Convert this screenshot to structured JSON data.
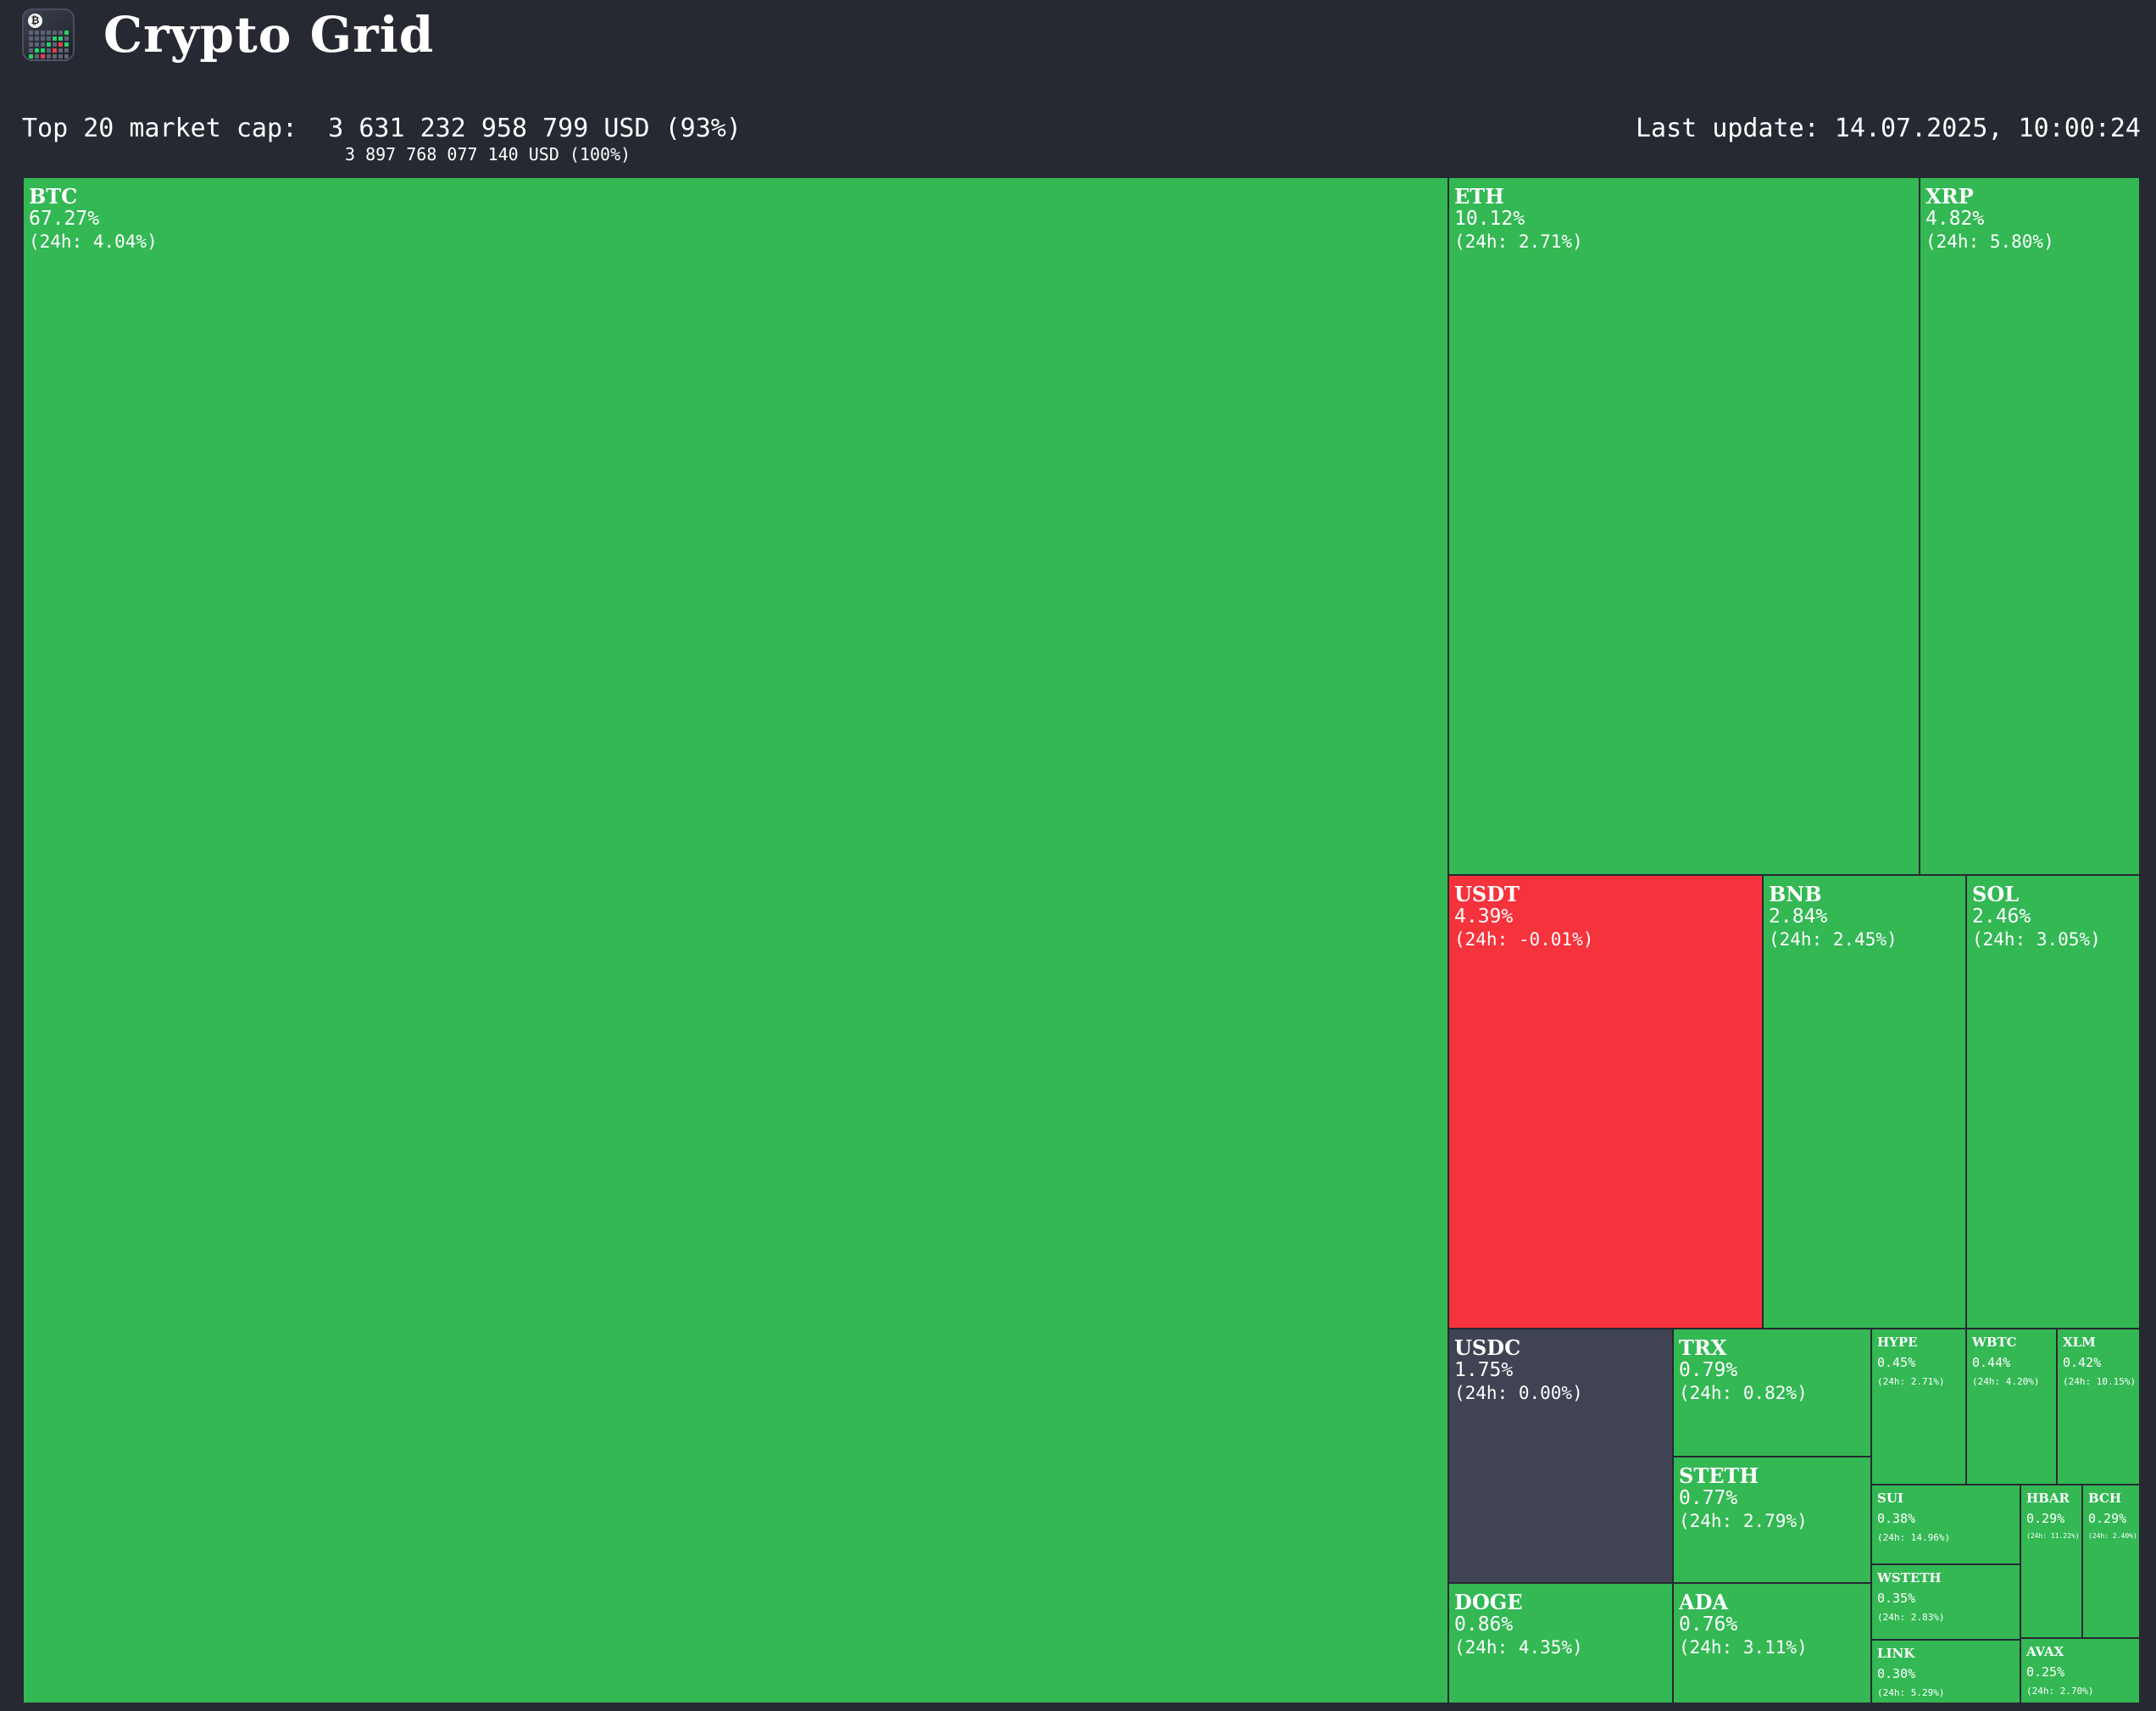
{
  "app": {
    "title": "Crypto Grid",
    "logo_icon": "bitcoin-grid-logo-icon"
  },
  "summary": {
    "label": "Top 20 market cap:",
    "top20_value": "3 631 232 958 799 USD (93%)",
    "total_value": "3 897 768 077 140 USD (100%)",
    "last_update_label": "Last update:",
    "last_update_value": "14.07.2025, 10:00:24"
  },
  "colors": {
    "background": "#262932",
    "positive": "#33b854",
    "negative": "#f5333c",
    "neutral": "#3f4353"
  },
  "tiles": [
    {
      "symbol": "BTC",
      "share": "67.27%",
      "change": "(24h: 4.04%)",
      "change_value": 4.04
    },
    {
      "symbol": "ETH",
      "share": "10.12%",
      "change": "(24h: 2.71%)",
      "change_value": 2.71
    },
    {
      "symbol": "XRP",
      "share": "4.82%",
      "change": "(24h: 5.80%)",
      "change_value": 5.8
    },
    {
      "symbol": "USDT",
      "share": "4.39%",
      "change": "(24h: -0.01%)",
      "change_value": -0.01
    },
    {
      "symbol": "BNB",
      "share": "2.84%",
      "change": "(24h: 2.45%)",
      "change_value": 2.45
    },
    {
      "symbol": "SOL",
      "share": "2.46%",
      "change": "(24h: 3.05%)",
      "change_value": 3.05
    },
    {
      "symbol": "USDC",
      "share": "1.75%",
      "change": "(24h: 0.00%)",
      "change_value": 0.0
    },
    {
      "symbol": "TRX",
      "share": "0.79%",
      "change": "(24h: 0.82%)",
      "change_value": 0.82
    },
    {
      "symbol": "STETH",
      "share": "0.77%",
      "change": "(24h: 2.79%)",
      "change_value": 2.79
    },
    {
      "symbol": "DOGE",
      "share": "0.86%",
      "change": "(24h: 4.35%)",
      "change_value": 4.35
    },
    {
      "symbol": "ADA",
      "share": "0.76%",
      "change": "(24h: 3.11%)",
      "change_value": 3.11
    },
    {
      "symbol": "HYPE",
      "share": "0.45%",
      "change": "(24h: 2.71%)",
      "change_value": 2.71
    },
    {
      "symbol": "WBTC",
      "share": "0.44%",
      "change": "(24h: 4.20%)",
      "change_value": 4.2
    },
    {
      "symbol": "XLM",
      "share": "0.42%",
      "change": "(24h: 10.15%)",
      "change_value": 10.15
    },
    {
      "symbol": "SUI",
      "share": "0.38%",
      "change": "(24h: 14.96%)",
      "change_value": 14.96
    },
    {
      "symbol": "HBAR",
      "share": "0.29%",
      "change": "(24h: 11.22%)",
      "change_value": 11.22
    },
    {
      "symbol": "BCH",
      "share": "0.29%",
      "change": "(24h: 2.40%)",
      "change_value": 2.4
    },
    {
      "symbol": "WSTETH",
      "share": "0.35%",
      "change": "(24h: 2.83%)",
      "change_value": 2.83
    },
    {
      "symbol": "LINK",
      "share": "0.30%",
      "change": "(24h: 5.29%)",
      "change_value": 5.29
    },
    {
      "symbol": "AVAX",
      "share": "0.25%",
      "change": "(24h: 2.70%)",
      "change_value": 2.7
    }
  ]
}
